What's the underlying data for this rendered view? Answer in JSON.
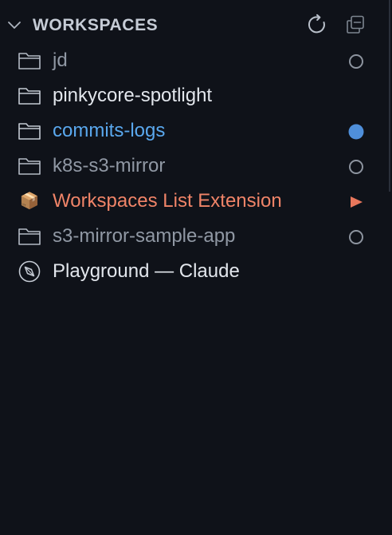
{
  "header": {
    "title": "WORKSPACES",
    "refresh_icon": "refresh-icon",
    "collapse_icon": "collapse-all-icon"
  },
  "workspaces": [
    {
      "label": "jd",
      "icon": "folder-icon",
      "status": "outline-circle",
      "tone": "dim"
    },
    {
      "label": "pinkycore-spotlight",
      "icon": "folder-icon",
      "status": "none",
      "tone": "bright"
    },
    {
      "label": "commits-logs",
      "icon": "folder-icon",
      "status": "filled-circle",
      "tone": "blue"
    },
    {
      "label": "k8s-s3-mirror",
      "icon": "folder-icon",
      "status": "outline-circle",
      "tone": "dim"
    },
    {
      "label": "Workspaces List Extension",
      "icon": "package-icon",
      "icon_glyph": "📦",
      "status": "play-triangle",
      "tone": "orange"
    },
    {
      "label": "s3-mirror-sample-app",
      "icon": "folder-icon",
      "status": "outline-circle",
      "tone": "dim"
    },
    {
      "label": "Playground — Claude",
      "icon": "compass-icon",
      "status": "none",
      "tone": "bright"
    }
  ],
  "colors": {
    "background": "#0f1219",
    "active_blue": "#4f8fda",
    "running_orange": "#e8775c",
    "dim_text": "#9098a4",
    "bright_text": "#e2e6ec"
  }
}
